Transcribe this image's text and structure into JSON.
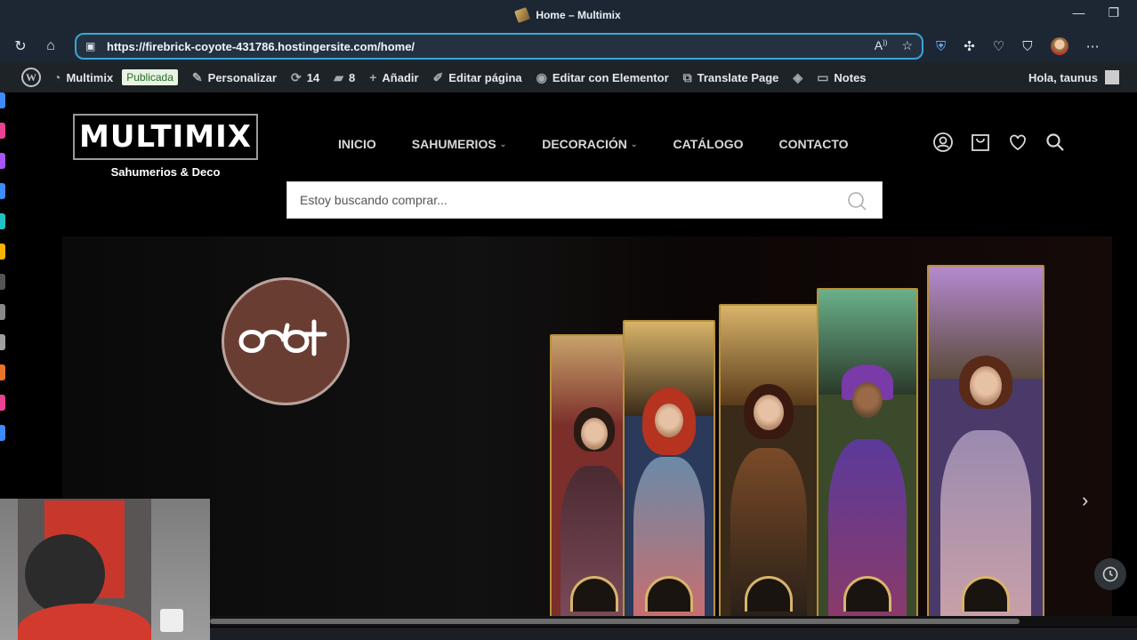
{
  "browser": {
    "title": "Home – Multimix",
    "url": "https://firebrick-coyote-431786.hostingersite.com/home/",
    "window_controls": [
      "—",
      "❐"
    ]
  },
  "wp_admin_bar": {
    "site_name": "Multimix",
    "status_badge": "Publicada",
    "customize": "Personalizar",
    "updates_count": "14",
    "comments_count": "8",
    "add_new": "Añadir",
    "edit_page": "Editar página",
    "edit_elementor": "Editar con Elementor",
    "translate": "Translate Page",
    "notes": "Notes",
    "greeting": "Hola, taunus"
  },
  "site": {
    "logo_text": "MULTIMIX",
    "logo_tagline": "Sahumerios & Deco",
    "menu": [
      {
        "label": "INICIO",
        "has_dropdown": false
      },
      {
        "label": "SAHUMERIOS",
        "has_dropdown": true
      },
      {
        "label": "DECORACIÓN",
        "has_dropdown": true
      },
      {
        "label": "CATÁLOGO",
        "has_dropdown": false
      },
      {
        "label": "CONTACTO",
        "has_dropdown": false
      }
    ],
    "header_icons": [
      "user-icon",
      "cart-icon",
      "heart-icon",
      "search-icon"
    ],
    "search_placeholder": "Estoy buscando comprar..."
  },
  "hero": {
    "brand_mark_color": "#6a3d33",
    "slider_arrows": [
      "‹",
      "›"
    ]
  },
  "colors": {
    "accent": "#3aa6d6",
    "wp_bar": "#1d2327",
    "gold": "#b8903a"
  }
}
